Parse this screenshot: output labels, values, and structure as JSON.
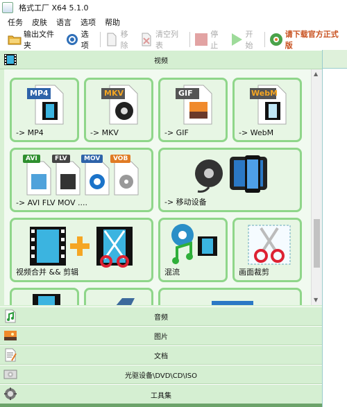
{
  "window": {
    "title": "格式工厂 X64 5.1.0"
  },
  "menu": [
    "任务",
    "皮肤",
    "语言",
    "选项",
    "帮助"
  ],
  "toolbar": {
    "output_folder": "输出文件夹",
    "options": "选项",
    "remove": "移除",
    "clear_list": "清空列表",
    "stop": "停止",
    "start": "开始",
    "download_official": "请下载官方正式版"
  },
  "categories": {
    "video": "视频",
    "audio": "音频",
    "image": "图片",
    "document": "文档",
    "disc": "光驱设备\\DVD\\CD\\ISO",
    "tools": "工具集"
  },
  "tiles": {
    "mp4": {
      "badge": "MP4",
      "label": "-> MP4"
    },
    "mkv": {
      "badge": "MKV",
      "label": "-> MKV"
    },
    "gif": {
      "badge": "GIF",
      "label": "-> GIF"
    },
    "webm": {
      "badge": "WebM",
      "label": "-> WebM"
    },
    "multi": {
      "badges": [
        "AVI",
        "FLV",
        "MOV",
        "VOB"
      ],
      "label": "-> AVI FLV MOV ...."
    },
    "mobile": {
      "label": "-> 移动设备"
    },
    "merge": {
      "label": "视频合并 && 剪辑"
    },
    "mix": {
      "label": "混流"
    },
    "crop": {
      "label": "画面裁剪"
    }
  },
  "colors": {
    "accent_green": "#8fd68a",
    "panel_bg": "#d8f0d4",
    "download_text": "#c8501e"
  }
}
